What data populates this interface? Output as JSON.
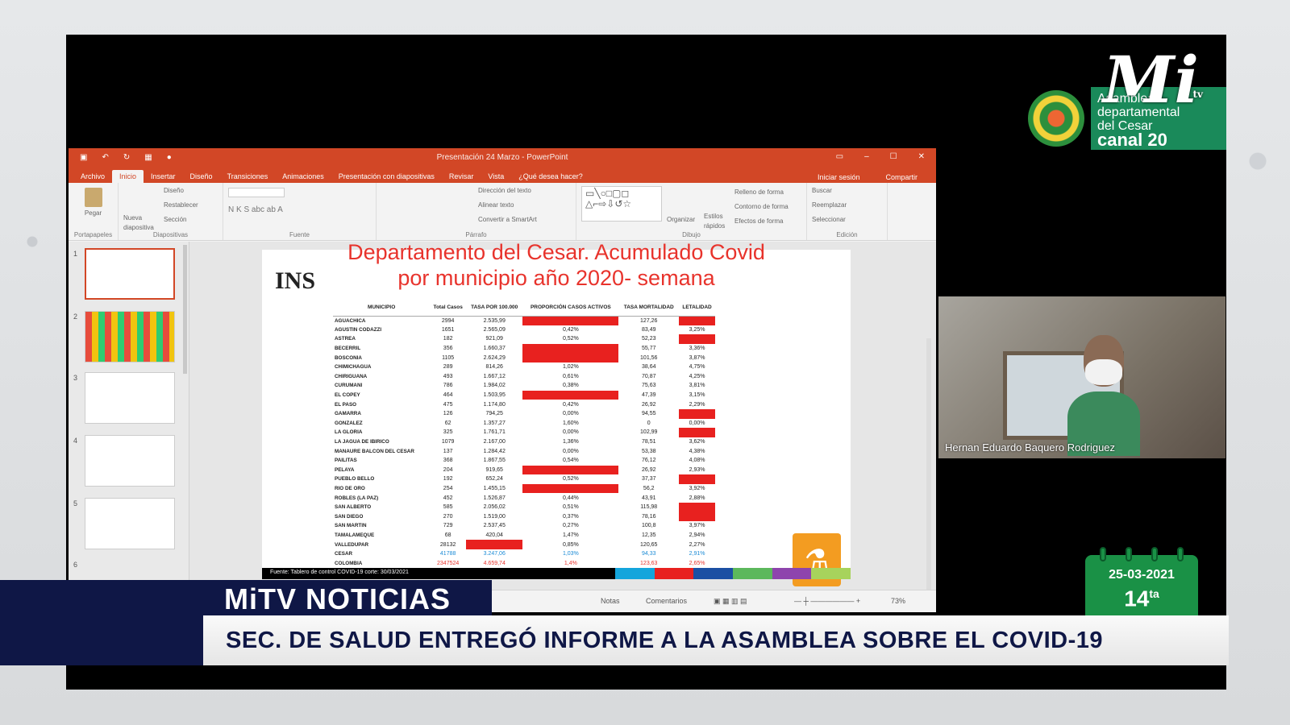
{
  "ppt": {
    "title": "Presentación 24 Marzo - PowerPoint",
    "tabs": [
      "Archivo",
      "Inicio",
      "Insertar",
      "Diseño",
      "Transiciones",
      "Animaciones",
      "Presentación con diapositivas",
      "Revisar",
      "Vista",
      "¿Qué desea hacer?"
    ],
    "active_tab": "Inicio",
    "signin": "Iniciar sesión",
    "share": "Compartir",
    "ribbon": {
      "pegar": "Pegar",
      "nueva": "Nueva diapositiva",
      "diseno": "Diseño",
      "restablecer": "Restablecer",
      "seccion": "Sección",
      "portapapeles": "Portapapeles",
      "diapositivas": "Diapositivas",
      "fuente": "Fuente",
      "direccion": "Dirección del texto",
      "alinear": "Alinear texto",
      "convertir": "Convertir a SmartArt",
      "parrafo": "Párrafo",
      "organizar": "Organizar",
      "estilos": "Estilos rápidos",
      "relleno": "Relleno de forma",
      "contorno": "Contorno de forma",
      "efectos": "Efectos de forma",
      "dibujo": "Dibujo",
      "buscar": "Buscar",
      "reemplazar": "Reemplazar",
      "seleccionar": "Seleccionar",
      "edicion": "Edición"
    },
    "thumbnails": [
      "1",
      "2",
      "3",
      "4",
      "5",
      "6"
    ],
    "status": {
      "notas": "Notas",
      "comentarios": "Comentarios",
      "zoom": "73%"
    }
  },
  "slide": {
    "title_line1": "Departamento del Cesar. Acumulado Covid",
    "title_line2": "por municipio año 2020-  semana",
    "logo": "INS",
    "columns": [
      "MUNICIPIO",
      "Total Casos",
      "TASA POR 100.000",
      "PROPORCIÓN CASOS ACTIVOS",
      "TASA MORTALIDAD",
      "LETALIDAD"
    ],
    "rows": [
      [
        "AGUACHICA",
        "2994",
        "2.535,99",
        "",
        "127,26",
        ""
      ],
      [
        "AGUSTIN CODAZZI",
        "1651",
        "2.565,09",
        "0,42%",
        "83,49",
        "3,25%"
      ],
      [
        "ASTREA",
        "182",
        "921,09",
        "0,52%",
        "52,23",
        ""
      ],
      [
        "BECERRIL",
        "356",
        "1.660,37",
        "",
        "55,77",
        "3,36%"
      ],
      [
        "BOSCONIA",
        "1105",
        "2.624,29",
        "",
        "101,56",
        "3,87%"
      ],
      [
        "CHIMICHAGUA",
        "289",
        "814,26",
        "1,02%",
        "38,64",
        "4,75%"
      ],
      [
        "CHIRIGUANA",
        "493",
        "1.667,12",
        "0,61%",
        "70,87",
        "4,25%"
      ],
      [
        "CURUMANI",
        "786",
        "1.984,02",
        "0,38%",
        "75,63",
        "3,81%"
      ],
      [
        "EL COPEY",
        "464",
        "1.503,95",
        "",
        "47,39",
        "3,15%"
      ],
      [
        "EL PASO",
        "475",
        "1.174,80",
        "0,42%",
        "26,92",
        "2,29%"
      ],
      [
        "GAMARRA",
        "126",
        "794,25",
        "0,00%",
        "94,55",
        ""
      ],
      [
        "GONZALEZ",
        "62",
        "1.357,27",
        "1,60%",
        "0",
        "0,00%"
      ],
      [
        "LA GLORIA",
        "325",
        "1.761,71",
        "0,00%",
        "102,99",
        ""
      ],
      [
        "LA JAGUA DE IBIRICO",
        "1079",
        "2.167,00",
        "1,36%",
        "78,51",
        "3,62%"
      ],
      [
        "MANAURE BALCON DEL CESAR",
        "137",
        "1.284,42",
        "0,00%",
        "53,38",
        "4,38%"
      ],
      [
        "PAILITAS",
        "368",
        "1.867,55",
        "0,54%",
        "76,12",
        "4,08%"
      ],
      [
        "PELAYA",
        "204",
        "919,65",
        "",
        "26,92",
        "2,93%"
      ],
      [
        "PUEBLO BELLO",
        "192",
        "652,24",
        "0,52%",
        "37,37",
        ""
      ],
      [
        "RIO DE ORO",
        "254",
        "1.455,15",
        "",
        "56,2",
        "3,92%"
      ],
      [
        "ROBLES (LA PAZ)",
        "452",
        "1.526,87",
        "0,44%",
        "43,91",
        "2,88%"
      ],
      [
        "SAN ALBERTO",
        "585",
        "2.056,02",
        "0,51%",
        "115,98",
        ""
      ],
      [
        "SAN DIEGO",
        "270",
        "1.519,00",
        "0,37%",
        "78,16",
        ""
      ],
      [
        "SAN MARTIN",
        "729",
        "2.537,45",
        "0,27%",
        "100,8",
        "3,97%"
      ],
      [
        "TAMALAMEQUE",
        "68",
        "420,04",
        "1,47%",
        "12,35",
        "2,94%"
      ],
      [
        "VALLEDUPAR",
        "28132",
        "",
        "0,85%",
        "120,65",
        "2,27%"
      ],
      [
        "CESAR",
        "41788",
        "3.247,06",
        "1,03%",
        "94,33",
        "2,91%"
      ],
      [
        "COLOMBIA",
        "2347524",
        "4.659,74",
        "1,4%",
        "123,63",
        "2,65%"
      ]
    ],
    "red_cells": {
      "activos": [
        0,
        3,
        4,
        8,
        16,
        18
      ],
      "letalidad": [
        0,
        2,
        10,
        12,
        17,
        20,
        21
      ],
      "tasa": [
        24
      ]
    },
    "fuente": "Fuente: Tablero de control COVID-19  corte: 30/03/2021",
    "bar_colors": [
      "#000000",
      "#000000",
      "#000000",
      "#000000",
      "#000000",
      "#000000",
      "#000000",
      "#000000",
      "#000000",
      "#14a5dc",
      "#e8211f",
      "#1b4fa3",
      "#5cb85c",
      "#8e44ad",
      "#a7d35c"
    ]
  },
  "camera": {
    "name": "Hernan Eduardo Baquero Rodriguez"
  },
  "logos": {
    "asamblea_line1": "Asamblea",
    "asamblea_line2": "departamental",
    "asamblea_line3": "del Cesar",
    "canal": "canal 20",
    "mitv": "Mi",
    "mitv_tv": "tv"
  },
  "calendar": {
    "date": "25-03-2021",
    "ordinal": "14",
    "ordinal_suffix": "ta"
  },
  "lower_third": {
    "brand": "MiTV NOTICIAS",
    "headline": "SEC. DE SALUD ENTREGÓ INFORME A LA ASAMBLEA SOBRE EL COVID-19"
  }
}
